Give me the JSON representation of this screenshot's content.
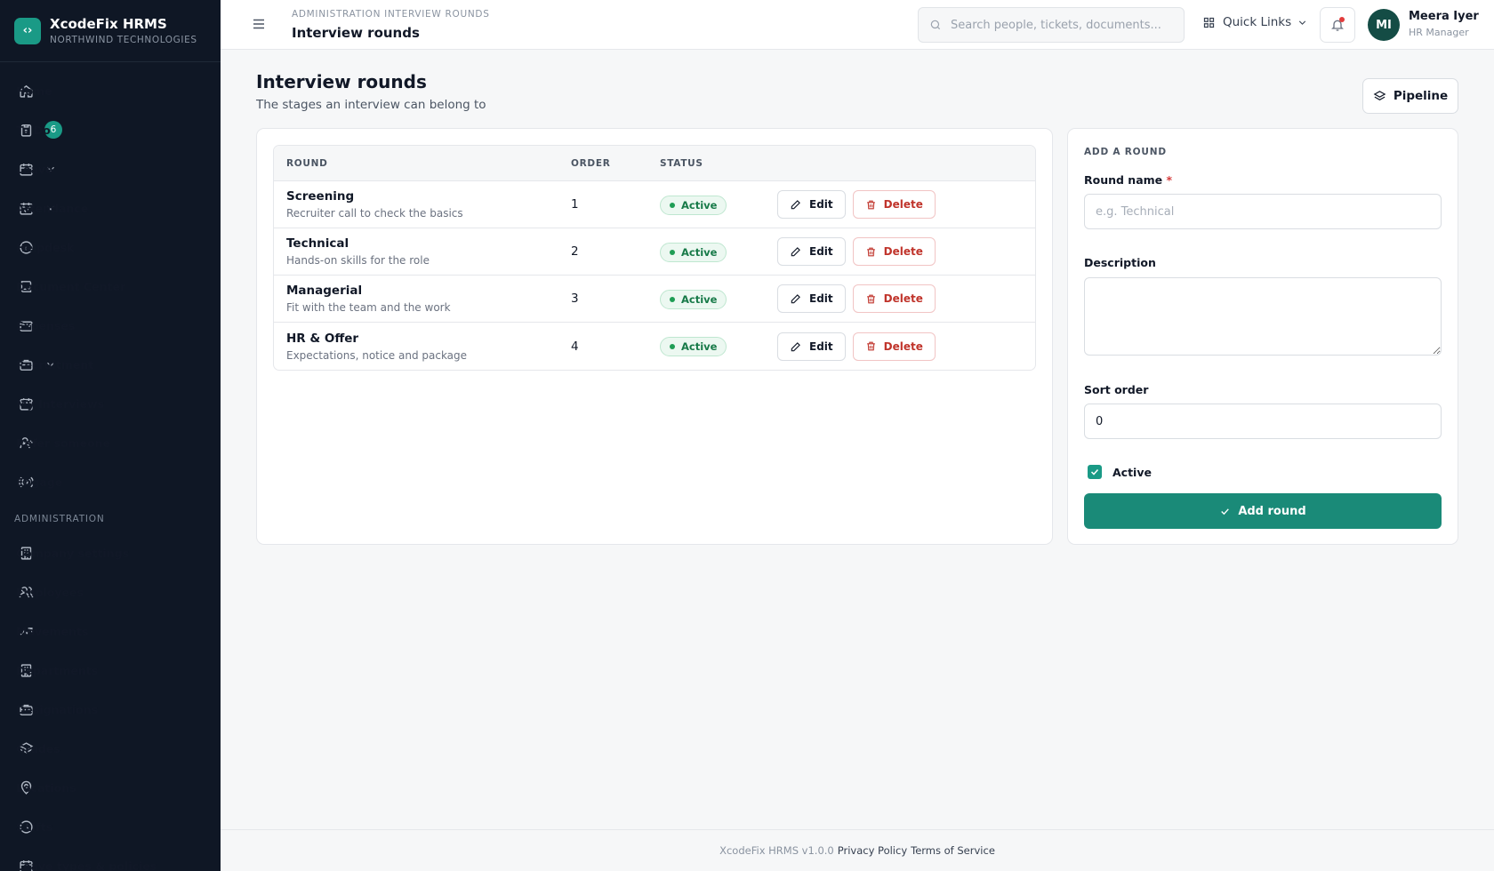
{
  "brand": {
    "name": "XcodeFix HRMS",
    "company": "NORTHWIND TECHNOLOGIES"
  },
  "sidebar": {
    "items": [
      {
        "label": "Home",
        "icon": "home-icon"
      },
      {
        "label": "To Do",
        "icon": "clipboard-icon",
        "badge": "6"
      },
      {
        "label": "Leave",
        "icon": "calendar-icon",
        "expandable": true
      },
      {
        "label": "Attendance",
        "icon": "calendar-check-icon",
        "expandable": true
      },
      {
        "label": "Helpdesk",
        "icon": "info-icon"
      },
      {
        "label": "Document Center",
        "icon": "book-icon"
      },
      {
        "label": "Expenses",
        "icon": "wallet-icon"
      },
      {
        "label": "Recruitment",
        "icon": "briefcase-icon",
        "expandable": true
      },
      {
        "label": "My Interviews",
        "icon": "calendar-icon"
      },
      {
        "label": "Refer someone",
        "icon": "user-plus-icon"
      },
      {
        "label": "Engage",
        "icon": "broadcast-icon"
      }
    ],
    "admin_section": "ADMINISTRATION",
    "admin_items": [
      {
        "label": "Company settings",
        "icon": "building-icon"
      },
      {
        "label": "Employees",
        "icon": "users-icon"
      },
      {
        "label": "Movements",
        "icon": "trending-icon"
      },
      {
        "label": "Departments",
        "icon": "building-icon"
      },
      {
        "label": "Designations",
        "icon": "briefcase-icon"
      },
      {
        "label": "Grades",
        "icon": "layers-icon"
      },
      {
        "label": "Locations",
        "icon": "pin-icon"
      },
      {
        "label": "Shifts",
        "icon": "clock-icon"
      },
      {
        "label": "Leave types & policies",
        "icon": "calendar-icon"
      }
    ]
  },
  "header": {
    "breadcrumb": "ADMINISTRATION INTERVIEW ROUNDS",
    "title": "Interview rounds",
    "search_placeholder": "Search people, tickets, documents...",
    "quick_links": "Quick Links",
    "user": {
      "initials": "MI",
      "name": "Meera Iyer",
      "role": "HR Manager"
    }
  },
  "page": {
    "title": "Interview rounds",
    "subtitle": "The stages an interview can belong to",
    "pipeline_button": "Pipeline"
  },
  "table": {
    "headers": {
      "round": "ROUND",
      "order": "ORDER",
      "status": "STATUS"
    },
    "edit_label": "Edit",
    "delete_label": "Delete",
    "rows": [
      {
        "name": "Screening",
        "description": "Recruiter call to check the basics",
        "order": "1",
        "status": "Active"
      },
      {
        "name": "Technical",
        "description": "Hands-on skills for the role",
        "order": "2",
        "status": "Active"
      },
      {
        "name": "Managerial",
        "description": "Fit with the team and the work",
        "order": "3",
        "status": "Active"
      },
      {
        "name": "HR & Offer",
        "description": "Expectations, notice and package",
        "order": "4",
        "status": "Active"
      }
    ]
  },
  "form": {
    "heading": "ADD A ROUND",
    "round_name_label": "Round name",
    "required_mark": "*",
    "round_name_placeholder": "e.g. Technical",
    "description_label": "Description",
    "sort_order_label": "Sort order",
    "sort_order_value": "0",
    "active_label": "Active",
    "active_checked": true,
    "submit_label": "Add round"
  },
  "footer": {
    "version": "XcodeFix HRMS v1.0.0",
    "privacy": "Privacy Policy",
    "terms": "Terms of Service"
  },
  "colors": {
    "accent": "#1a9a86",
    "sidebar_bg": "#0f1725",
    "danger": "#c0342b",
    "success": "#1f9d55"
  }
}
